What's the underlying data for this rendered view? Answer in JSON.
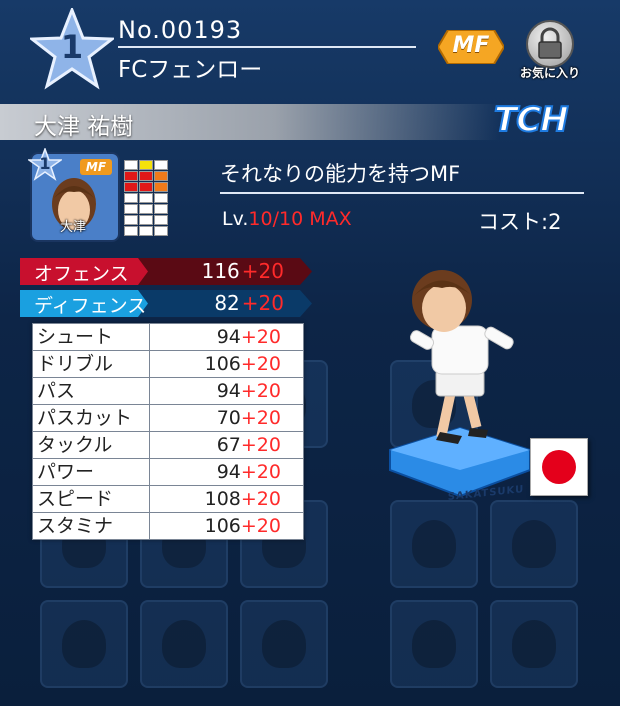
{
  "header": {
    "rarity": "1",
    "player_no": "No.00193",
    "team": "FCフェンロー",
    "position": "MF",
    "favorite_label": "お気に入り"
  },
  "player": {
    "name": "大津 祐樹",
    "portrait_name": "大津",
    "portrait_rarity": "1",
    "portrait_position": "MF",
    "type_logo": "TCH",
    "description": "それなりの能力を持つMF",
    "level_prefix": "Lv.",
    "level_value": "10/10 MAX",
    "cost": "コスト:2",
    "nationality_flag": "japan-flag"
  },
  "summary": [
    {
      "label": "オフェンス",
      "value": "116",
      "bonus": "+20",
      "color": "#c8102e"
    },
    {
      "label": "ディフェンス",
      "value": "82",
      "bonus": "+20",
      "color": "#1aa0e0"
    }
  ],
  "stats": [
    {
      "name": "シュート",
      "value": "94",
      "bonus": "+20"
    },
    {
      "name": "ドリブル",
      "value": "106",
      "bonus": "+20"
    },
    {
      "name": "パス",
      "value": "94",
      "bonus": "+20"
    },
    {
      "name": "パスカット",
      "value": "70",
      "bonus": "+20"
    },
    {
      "name": "タックル",
      "value": "67",
      "bonus": "+20"
    },
    {
      "name": "パワー",
      "value": "94",
      "bonus": "+20"
    },
    {
      "name": "スピード",
      "value": "108",
      "bonus": "+20"
    },
    {
      "name": "スタミナ",
      "value": "106",
      "bonus": "+20"
    }
  ],
  "formation_highlight": {
    "yellow": [
      "0-1"
    ],
    "red": [
      "1-0",
      "1-1",
      "2-0",
      "2-1"
    ],
    "orange": [
      "1-2",
      "2-2"
    ]
  },
  "figure_base_label": "SAKATSUKU",
  "colors": {
    "accent_red": "#ff2a2a",
    "position_badge": "#f09a1e",
    "background": "#0f2a4e"
  }
}
